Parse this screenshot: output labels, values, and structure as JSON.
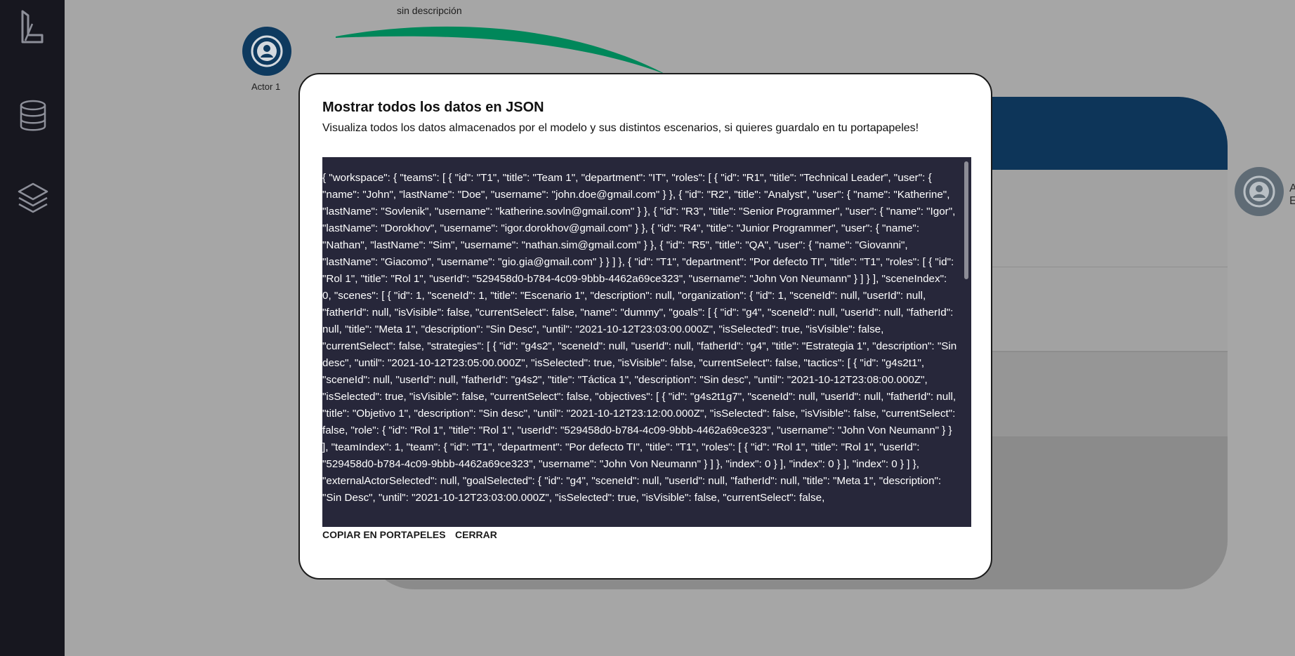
{
  "sidebar": {
    "icons": [
      "logo-icon",
      "database-icon",
      "layers-icon"
    ]
  },
  "canvas": {
    "edge_label": "sin descripción",
    "actor1_label": "Actor 1",
    "side_actor_text_1": "A",
    "side_actor_text_2": "E",
    "colors": {
      "actor": "#0e3a5f",
      "edge": "#00875a",
      "card_header": "#0d3559"
    }
  },
  "modal": {
    "title": "Mostrar todos los datos en JSON",
    "subtitle": "Visualiza todos los datos almacenados por el modelo y sus distintos escenarios, si quieres guardalo en tu portapapeles!",
    "json_text": "{ \"workspace\": { \"teams\": [ { \"id\": \"T1\", \"title\": \"Team 1\", \"department\": \"IT\", \"roles\": [ { \"id\": \"R1\", \"title\": \"Technical Leader\", \"user\": { \"name\": \"John\", \"lastName\": \"Doe\", \"username\": \"john.doe@gmail.com\" } }, { \"id\": \"R2\", \"title\": \"Analyst\", \"user\": { \"name\": \"Katherine\", \"lastName\": \"Sovlenik\", \"username\": \"katherine.sovln@gmail.com\" } }, { \"id\": \"R3\", \"title\": \"Senior Programmer\", \"user\": { \"name\": \"Igor\", \"lastName\": \"Dorokhov\", \"username\": \"igor.dorokhov@gmail.com\" } }, { \"id\": \"R4\", \"title\": \"Junior Programmer\", \"user\": { \"name\": \"Nathan\", \"lastName\": \"Sim\", \"username\": \"nathan.sim@gmail.com\" } }, { \"id\": \"R5\", \"title\": \"QA\", \"user\": { \"name\": \"Giovanni\", \"lastName\": \"Giacomo\", \"username\": \"gio.gia@gmail.com\" } } ] }, { \"id\": \"T1\", \"department\": \"Por defecto TI\", \"title\": \"T1\", \"roles\": [ { \"id\": \"Rol 1\", \"title\": \"Rol 1\", \"userId\": \"529458d0-b784-4c09-9bbb-4462a69ce323\", \"username\": \"John Von Neumann\" } ] } ], \"sceneIndex\": 0, \"scenes\": [ { \"id\": 1, \"sceneId\": 1, \"title\": \"Escenario 1\", \"description\": null, \"organization\": { \"id\": 1, \"sceneId\": null, \"userId\": null, \"fatherId\": null, \"isVisible\": false, \"currentSelect\": false, \"name\": \"dummy\", \"goals\": [ { \"id\": \"g4\", \"sceneId\": null, \"userId\": null, \"fatherId\": null, \"title\": \"Meta 1\", \"description\": \"Sin Desc\", \"until\": \"2021-10-12T23:03:00.000Z\", \"isSelected\": true, \"isVisible\": false, \"currentSelect\": false, \"strategies\": [ { \"id\": \"g4s2\", \"sceneId\": null, \"userId\": null, \"fatherId\": \"g4\", \"title\": \"Estrategia 1\", \"description\": \"Sin desc\", \"until\": \"2021-10-12T23:05:00.000Z\", \"isSelected\": true, \"isVisible\": false, \"currentSelect\": false, \"tactics\": [ { \"id\": \"g4s2t1\", \"sceneId\": null, \"userId\": null, \"fatherId\": \"g4s2\", \"title\": \"Táctica 1\", \"description\": \"Sin desc\", \"until\": \"2021-10-12T23:08:00.000Z\", \"isSelected\": true, \"isVisible\": false, \"currentSelect\": false, \"objectives\": [ { \"id\": \"g4s2t1g7\", \"sceneId\": null, \"userId\": null, \"fatherId\": null, \"title\": \"Objetivo 1\", \"description\": \"Sin desc\", \"until\": \"2021-10-12T23:12:00.000Z\", \"isSelected\": false, \"isVisible\": false, \"currentSelect\": false, \"role\": { \"id\": \"Rol 1\", \"title\": \"Rol 1\", \"userId\": \"529458d0-b784-4c09-9bbb-4462a69ce323\", \"username\": \"John Von Neumann\" } } ], \"teamIndex\": 1, \"team\": { \"id\": \"T1\", \"department\": \"Por defecto TI\", \"title\": \"T1\", \"roles\": [ { \"id\": \"Rol 1\", \"title\": \"Rol 1\", \"userId\": \"529458d0-b784-4c09-9bbb-4462a69ce323\", \"username\": \"John Von Neumann\" } ] }, \"index\": 0 } ], \"index\": 0 } ], \"index\": 0 } ] }, \"externalActorSelected\": null, \"goalSelected\": { \"id\": \"g4\", \"sceneId\": null, \"userId\": null, \"fatherId\": null, \"title\": \"Meta 1\", \"description\": \"Sin Desc\", \"until\": \"2021-10-12T23:03:00.000Z\", \"isSelected\": true, \"isVisible\": false, \"currentSelect\": false,",
    "copy_button": "COPIAR EN PORTAPELES",
    "close_button": "CERRAR"
  }
}
